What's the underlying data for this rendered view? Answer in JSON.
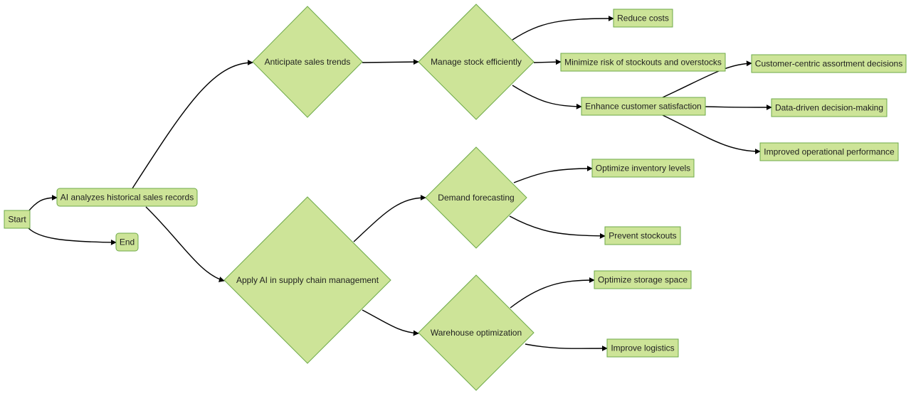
{
  "diagram": {
    "type": "flowchart",
    "direction": "left-to-right",
    "colors": {
      "node_fill": "#cde498",
      "node_stroke": "#6eaa49",
      "edge": "#000000",
      "text": "#1f1f1f",
      "background": "#ffffff"
    },
    "nodes": [
      {
        "id": "start",
        "label": "Start",
        "shape": "rect"
      },
      {
        "id": "analyze",
        "label": "AI analyzes historical sales records",
        "shape": "rounded-rect"
      },
      {
        "id": "end",
        "label": "End",
        "shape": "rounded-rect"
      },
      {
        "id": "anticipate",
        "label": "Anticipate sales trends",
        "shape": "diamond"
      },
      {
        "id": "apply",
        "label": "Apply AI in supply chain management",
        "shape": "diamond"
      },
      {
        "id": "manage",
        "label": "Manage stock efficiently",
        "shape": "diamond"
      },
      {
        "id": "demand",
        "label": "Demand forecasting",
        "shape": "diamond"
      },
      {
        "id": "warehouse",
        "label": "Warehouse optimization",
        "shape": "diamond"
      },
      {
        "id": "reduce",
        "label": "Reduce costs",
        "shape": "rect"
      },
      {
        "id": "minimize",
        "label": "Minimize risk of stockouts and overstocks",
        "shape": "rect"
      },
      {
        "id": "enhance",
        "label": "Enhance customer satisfaction",
        "shape": "rect"
      },
      {
        "id": "customer",
        "label": "Customer-centric assortment decisions",
        "shape": "rect"
      },
      {
        "id": "datadriven",
        "label": "Data-driven decision-making",
        "shape": "rect"
      },
      {
        "id": "improved",
        "label": "Improved operational performance",
        "shape": "rect"
      },
      {
        "id": "optinv",
        "label": "Optimize inventory levels",
        "shape": "rect"
      },
      {
        "id": "prevent",
        "label": "Prevent stockouts",
        "shape": "rect"
      },
      {
        "id": "optstor",
        "label": "Optimize storage space",
        "shape": "rect"
      },
      {
        "id": "logistics",
        "label": "Improve logistics",
        "shape": "rect"
      }
    ],
    "edges": [
      {
        "from": "start",
        "to": "analyze"
      },
      {
        "from": "start",
        "to": "end"
      },
      {
        "from": "analyze",
        "to": "anticipate"
      },
      {
        "from": "analyze",
        "to": "apply"
      },
      {
        "from": "anticipate",
        "to": "manage"
      },
      {
        "from": "manage",
        "to": "reduce"
      },
      {
        "from": "manage",
        "to": "minimize"
      },
      {
        "from": "manage",
        "to": "enhance"
      },
      {
        "from": "enhance",
        "to": "customer"
      },
      {
        "from": "enhance",
        "to": "datadriven"
      },
      {
        "from": "enhance",
        "to": "improved"
      },
      {
        "from": "apply",
        "to": "demand"
      },
      {
        "from": "apply",
        "to": "warehouse"
      },
      {
        "from": "demand",
        "to": "optinv"
      },
      {
        "from": "demand",
        "to": "prevent"
      },
      {
        "from": "warehouse",
        "to": "optstor"
      },
      {
        "from": "warehouse",
        "to": "logistics"
      }
    ]
  }
}
